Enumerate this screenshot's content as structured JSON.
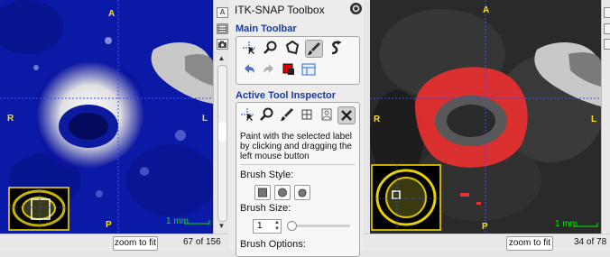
{
  "left_view": {
    "orient": {
      "top": "A",
      "left": "R",
      "right": "L",
      "bottom": "P"
    },
    "scale_label": "1 mm",
    "zoom_button": "zoom to fit",
    "slice_text": "67 of 156",
    "side_icons": [
      "A",
      "table-icon",
      "camera-icon"
    ]
  },
  "right_view": {
    "orient": {
      "top": "A",
      "left": "R",
      "right": "L",
      "bottom": "P"
    },
    "scale_label": "1 mm",
    "zoom_button": "zoom to fit",
    "slice_text": "34 of 78"
  },
  "panel": {
    "title": "ITK-SNAP Toolbox",
    "main_toolbar_title": "Main Toolbar",
    "main_toolbar_tools": [
      "crosshair-icon",
      "zoom-icon",
      "polygon-icon",
      "paintbrush-icon",
      "snake-icon"
    ],
    "main_toolbar_row2": [
      "undo-icon",
      "redo-icon",
      "label-color-icon",
      "layout-icon"
    ],
    "inspector_title": "Active Tool Inspector",
    "inspector_tools": [
      "crosshair-icon",
      "zoom-icon",
      "paintbrush-icon",
      "table-icon",
      "annotation-icon",
      "tools-icon"
    ],
    "description": "Paint with the selected label by clicking and dragging the left mouse button",
    "brush_style_label": "Brush Style:",
    "brush_size_label": "Brush Size:",
    "brush_size_value": "1",
    "brush_options_label": "Brush Options:"
  },
  "colors": {
    "accent": "#1a3a9c",
    "crosshair": "#3b4cff",
    "orient": "#ffe000",
    "scale": "#00e600",
    "segmentation": "#e83030"
  }
}
